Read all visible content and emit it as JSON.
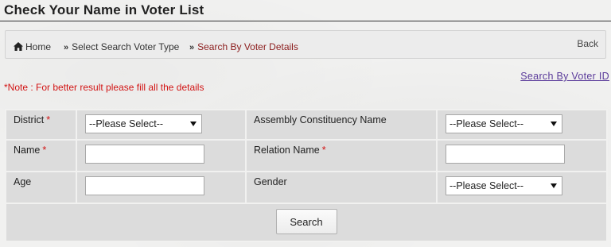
{
  "page": {
    "title": "Check Your Name in Voter List"
  },
  "breadcrumb": {
    "home": "Home",
    "select_type": "Select Search Voter Type",
    "current": "Search By Voter Details",
    "back": "Back",
    "home_icon": "home-icon",
    "separator": "»"
  },
  "note": "*Note : For better result please fill all the details",
  "alt_search_link": "Search By Voter ID",
  "form": {
    "required_mark": "*",
    "district": {
      "label": "District",
      "value": "--Please Select--"
    },
    "assembly": {
      "label": "Assembly Constituency Name",
      "value": "--Please Select--"
    },
    "name": {
      "label": "Name",
      "value": ""
    },
    "relation": {
      "label": "Relation Name",
      "value": ""
    },
    "age": {
      "label": "Age",
      "value": ""
    },
    "gender": {
      "label": "Gender",
      "value": "--Please Select--"
    },
    "search_button": "Search"
  },
  "colors": {
    "required": "#d21414",
    "active_crumb": "#8b1c1c",
    "link": "#5a3a9a"
  }
}
